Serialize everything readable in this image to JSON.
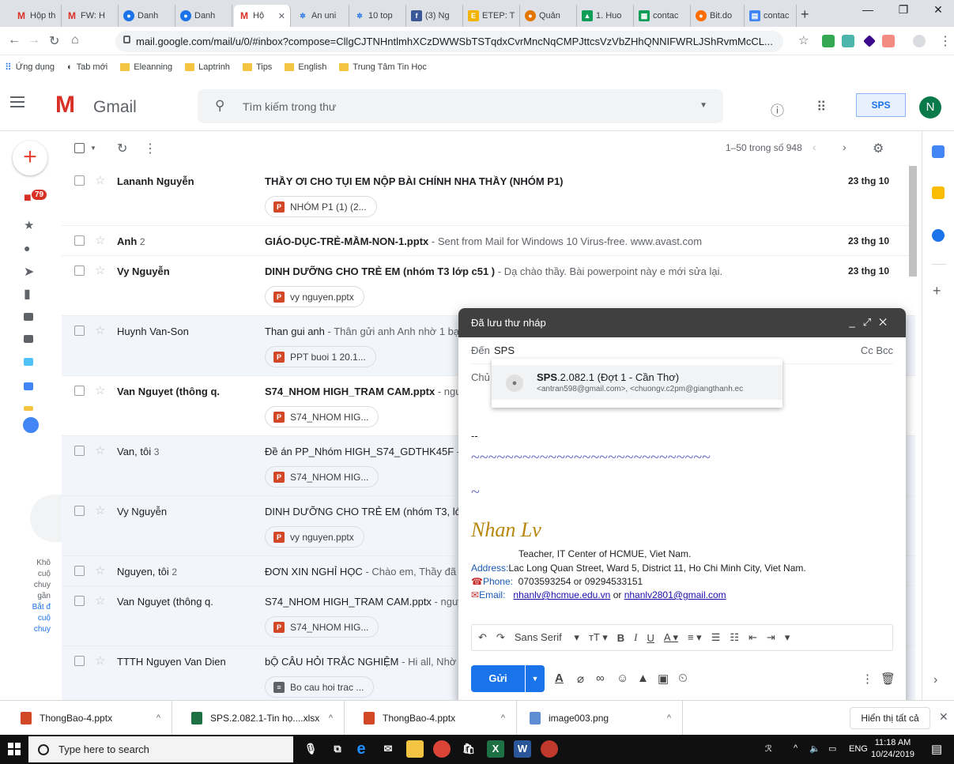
{
  "tabs": [
    {
      "label": "Hộp th",
      "icon": "gmail-icon"
    },
    {
      "label": "FW: H",
      "icon": "gmail-icon"
    },
    {
      "label": "Danh",
      "icon": "danh-icon"
    },
    {
      "label": "Danh",
      "icon": "danh-icon"
    },
    {
      "label": "Hộ",
      "icon": "gmail-icon",
      "active": true
    },
    {
      "label": "An uni",
      "icon": "site-icon"
    },
    {
      "label": "10 top",
      "icon": "site-icon"
    },
    {
      "label": "(3) Ng",
      "icon": "facebook-icon"
    },
    {
      "label": "ETEP: T",
      "icon": "etep-icon"
    },
    {
      "label": "Quản",
      "icon": "site-icon"
    },
    {
      "label": "1. Huo",
      "icon": "drive-icon"
    },
    {
      "label": "contac",
      "icon": "sheets-icon"
    },
    {
      "label": "Bit.do",
      "icon": "bitdo-icon"
    },
    {
      "label": "contac",
      "icon": "docs-icon"
    }
  ],
  "address_bar": {
    "url": "mail.google.com/mail/u/0/#inbox?compose=CllgCJTNHntlmhXCzDWWSbTSTqdxCvrMncNqCMPJttcsVzVbZHhQNNIFWRLJShRvmMcCL..."
  },
  "bookmarks": {
    "apps": "Ứng dụng",
    "items": [
      "Tab mới",
      "Eleanning",
      "Laptrinh",
      "Tips",
      "English",
      "Trung Tâm Tin Học"
    ]
  },
  "gmail": {
    "logo": "Gmail",
    "search_placeholder": "Tìm kiếm trong thư",
    "avatar_letter": "N",
    "account_logo": "SPS",
    "inbox_badge": "79",
    "pager": "1–50 trong số 948"
  },
  "emails": [
    {
      "sender": "Lananh Nguyễn",
      "count": "",
      "subject": "THẦY ƠI CHO TỤI EM NỘP BÀI CHÍNH NHA THẦY (NHÓM P1)",
      "snippet": "",
      "date": "23 thg 10",
      "attachment": "NHÓM P1 (1) (2...",
      "unread": true
    },
    {
      "sender": "Anh",
      "count": "2",
      "subject": "GIÁO-DỤC-TRẺ-MẦM-NON-1.pptx",
      "snippet": " - Sent from Mail for Windows 10 Virus-free. www.avast.com",
      "date": "23 thg 10",
      "attachment": "",
      "unread": true
    },
    {
      "sender": "Vy Nguyễn",
      "count": "",
      "subject": "DINH DƯỠNG CHO TRẺ EM (nhóm T3 lớp c51 )",
      "snippet": " - Dạ chào thầy. Bài powerpoint này e mới sửa lại.",
      "date": "23 thg 10",
      "attachment": "vy nguyen.pptx",
      "unread": true
    },
    {
      "sender": "Huynh Van-Son",
      "count": "",
      "subject": "Than gui anh",
      "snippet": " - Thân gửi anh Anh nhờ 1 bạ",
      "date": "",
      "attachment": "PPT buoi 1 20.1...",
      "unread": false
    },
    {
      "sender": "Van Nguyet (thông q.",
      "count": "",
      "subject": "S74_NHOM HIGH_TRAM CAM.pptx",
      "snippet": " - ngu",
      "date": "",
      "attachment": "S74_NHOM HIG...",
      "unread": true
    },
    {
      "sender": "Van, tôi",
      "count": "3",
      "subject": "Đề án PP_Nhóm HIGH_S74_GDTHK45F",
      "snippet": " -",
      "date": "",
      "attachment": "S74_NHOM HIG...",
      "unread": false
    },
    {
      "sender": "Vy Nguyễn",
      "count": "",
      "subject": "DINH DƯỠNG CHO TRẺ EM (nhóm T3, lớp",
      "snippet": "",
      "date": "",
      "attachment": "vy nguyen.pptx",
      "unread": false
    },
    {
      "sender": "Nguyen, tôi",
      "count": "2",
      "subject": "ĐƠN XIN NGHỈ HỌC",
      "snippet": " - Chào em, Thầy đã n",
      "date": "",
      "attachment": "",
      "unread": false
    },
    {
      "sender": "Van Nguyet (thông q.",
      "count": "",
      "subject": "S74_NHOM HIGH_TRAM CAM.pptx",
      "snippet": " - nguy",
      "date": "",
      "attachment": "S74_NHOM HIG...",
      "unread": false
    },
    {
      "sender": "TTTH Nguyen Van Dien",
      "count": "",
      "subject": "bỘ CÂU HỎI TRẮC NGHIỆM",
      "snippet": " - Hi all, Nhờ n",
      "date": "",
      "attachment": "Bo cau hoi trac ...",
      "unread": false
    }
  ],
  "hangouts_text": [
    "Khô",
    "cuộ",
    "chuy",
    "gần",
    "Bắt đ",
    "cuộ",
    "chuy"
  ],
  "compose": {
    "title": "Đã lưu thư nháp",
    "to_label": "Đến",
    "to_value": "SPS",
    "cc_bcc": "Cc Bcc",
    "subject_label": "Chủ",
    "suggestion_bold": "SPS",
    "suggestion_rest": ".2.082.1 (Đợt 1 - Cần Thơ)",
    "suggestion_addr": "<antran598@gmail.com>, <chuongv.c2pm@giangthanh.ec",
    "sig_dash": "--",
    "sig_tilde1": "~~~~~~~~~~~~~~~~~~~~~~~~~~~~",
    "sig_tilde2": "~",
    "sig_name": "Nhan Lv",
    "sig_role": "Teacher, IT Center of HCMUE, Viet Nam.",
    "sig_address_label": "Address:",
    "sig_address": "Lac Long Quan Street, Ward 5, District 11, Ho Chi Minh City, Viet Nam.",
    "sig_phone_label": "Phone:",
    "sig_phone": "0703593254 or 09294533151",
    "sig_email_label": "Email:",
    "sig_email1": "nhanlv@hcmue.edu.vn",
    "sig_or": " or ",
    "sig_email2": "nhanlv2801@gmail.com",
    "font_name": "Sans Serif",
    "send": "Gửi"
  },
  "downloads": [
    {
      "name": "ThongBao-4.pptx",
      "type": "ppt"
    },
    {
      "name": "SPS.2.082.1-Tin họ....xlsx",
      "type": "xls"
    },
    {
      "name": "ThongBao-4.pptx",
      "type": "ppt"
    },
    {
      "name": "image003.png",
      "type": "img"
    }
  ],
  "downloads_show_all": "Hiển thị tất cả",
  "taskbar": {
    "search_placeholder": "Type here to search",
    "lang": "ENG",
    "time": "11:18 AM",
    "date": "10/24/2019"
  },
  "colors": {
    "gmail_red": "#d93025",
    "compose_header": "#404040",
    "send_blue": "#1a73e8",
    "signature_gold": "#b8860b"
  }
}
